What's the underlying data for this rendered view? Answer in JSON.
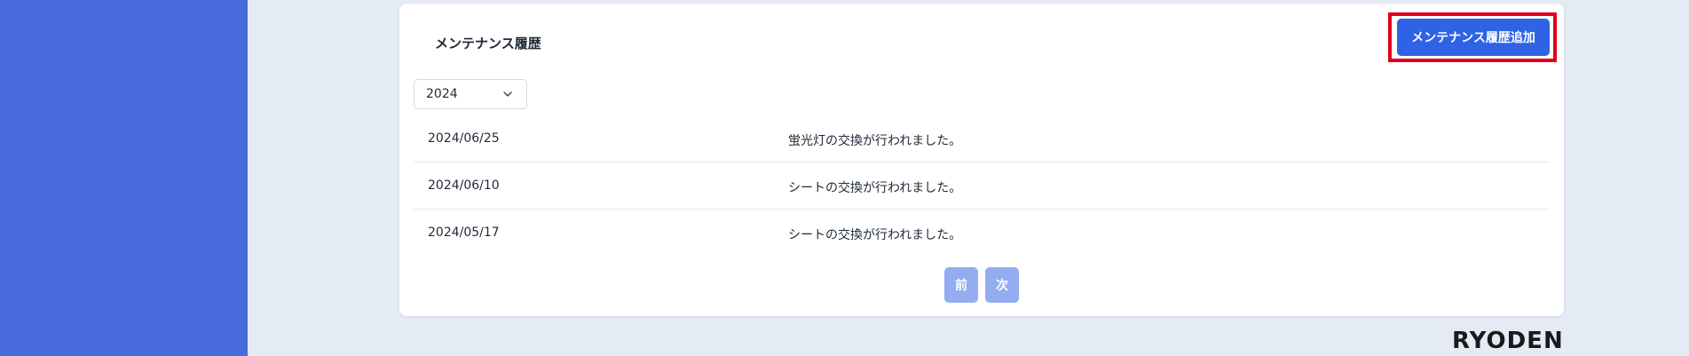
{
  "maintenance": {
    "title": "メンテナンス履歴",
    "add_button_label": "メンテナンス履歴追加",
    "year_filter": {
      "selected": "2024",
      "icon": "chevron-down-icon"
    },
    "records": [
      {
        "date": "2024/06/25",
        "description": "蛍光灯の交換が行われました。"
      },
      {
        "date": "2024/06/10",
        "description": "シートの交換が行われました。"
      },
      {
        "date": "2024/05/17",
        "description": "シートの交換が行われました。"
      }
    ],
    "pagination": {
      "prev_label": "前",
      "next_label": "次"
    }
  },
  "footer": {
    "brand": "RYODEN"
  },
  "colors": {
    "sidebar": "#4869d9",
    "background": "#e5ebf5",
    "primary_button": "#2f63e6",
    "disabled_button": "#94acf0",
    "highlight": "#e0001b"
  }
}
